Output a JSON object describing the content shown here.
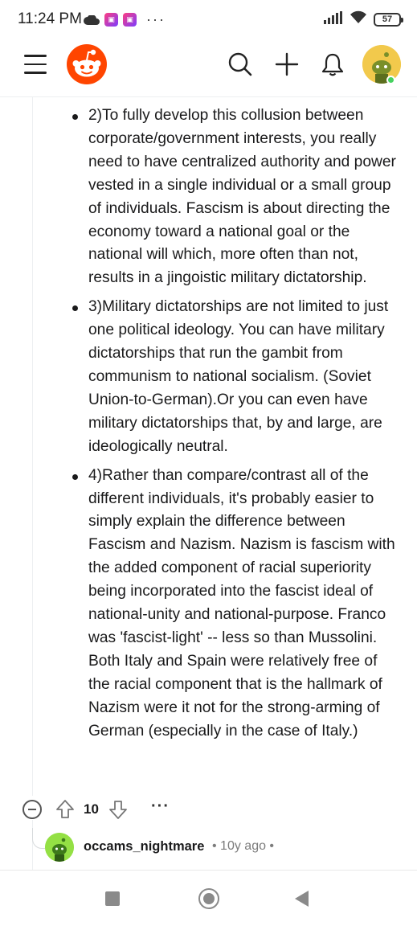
{
  "status_bar": {
    "time": "11:24 PM",
    "more": "···",
    "battery": "57",
    "icons": [
      "cloud-icon",
      "app-badge-icon",
      "app-badge-icon",
      "signal-icon",
      "wifi-icon",
      "battery-icon"
    ]
  },
  "header": {
    "icons": [
      "menu-icon",
      "reddit-logo",
      "search-icon",
      "plus-icon",
      "bell-icon",
      "avatar"
    ],
    "brand_color": "#ff4500",
    "online_color": "#46d160"
  },
  "comment": {
    "items": [
      "2)To fully develop this collusion between corporate/government interests, you really need to have centralized authority and power vested in a single individual or a small group of individuals. Fascism is about directing the economy toward a national goal or the national will which, more often than not, results in a jingoistic military dictatorship.",
      "3)Military dictatorships are not limited to just one political ideology. You can have military dictatorships that run the gambit from communism to national socialism. (Soviet Union-to-German).Or you can even have military dictatorships that, by and large, are ideologically neutral.",
      "4)Rather than compare/contrast all of the different individuals, it's probably easier to simply explain the difference between Fascism and Nazism. Nazism is fascism with the added component of racial superiority being incorporated into the fascist ideal of national-unity and national-purpose. Franco was 'fascist-light' -- less so than Mussolini. Both Italy and Spain were relatively free of the racial component that is the hallmark of Nazism were it not for the strong-arming of German (especially in the case of Italy.)"
    ],
    "actions": {
      "votes": "10",
      "more": "···"
    }
  },
  "reply": {
    "username": "occams_nightmare",
    "meta": "• 10y ago •"
  },
  "nav": {
    "icons": [
      "recents-icon",
      "home-icon",
      "back-icon"
    ]
  }
}
